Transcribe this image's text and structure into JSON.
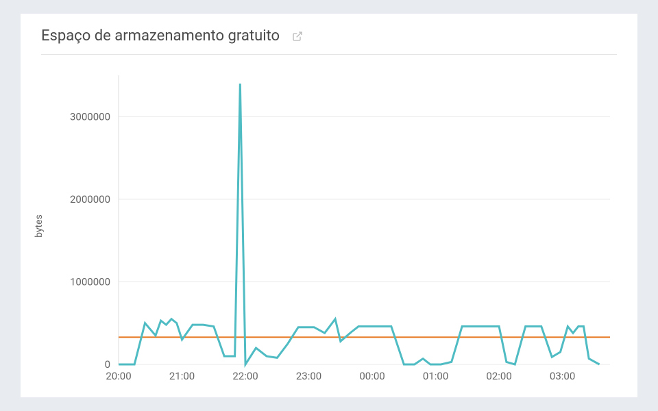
{
  "header": {
    "title": "Espaço de armazenamento gratuito"
  },
  "chart_data": {
    "type": "line",
    "title": "Espaço de armazenamento gratuito",
    "xlabel": "",
    "ylabel": "bytes",
    "ylim": [
      0,
      3500000
    ],
    "x_ticks": [
      "20:00",
      "21:00",
      "22:00",
      "23:00",
      "00:00",
      "01:00",
      "02:00",
      "03:00"
    ],
    "y_ticks": [
      0,
      1000000,
      2000000,
      3000000
    ],
    "reference_value": 330000,
    "series": [
      {
        "name": "bytes",
        "x": [
          "20:00",
          "20:15",
          "20:25",
          "20:35",
          "20:40",
          "20:45",
          "20:50",
          "20:55",
          "21:00",
          "21:10",
          "21:20",
          "21:30",
          "21:40",
          "21:50",
          "21:55",
          "22:00",
          "22:10",
          "22:20",
          "22:30",
          "22:40",
          "22:50",
          "22:58",
          "23:05",
          "23:15",
          "23:25",
          "23:30",
          "23:40",
          "23:47",
          "23:55",
          "00:00",
          "00:10",
          "00:18",
          "00:30",
          "00:40",
          "00:48",
          "00:55",
          "01:05",
          "01:15",
          "01:25",
          "01:35",
          "01:45",
          "01:55",
          "02:00",
          "02:07",
          "02:15",
          "02:25",
          "02:35",
          "02:40",
          "02:50",
          "02:58",
          "03:05",
          "03:10",
          "03:15",
          "03:20",
          "03:25",
          "03:35"
        ],
        "values": [
          0,
          0,
          500000,
          350000,
          530000,
          480000,
          550000,
          500000,
          300000,
          480000,
          480000,
          460000,
          100000,
          100000,
          3400000,
          0,
          200000,
          100000,
          80000,
          250000,
          450000,
          450000,
          450000,
          380000,
          550000,
          280000,
          390000,
          460000,
          460000,
          460000,
          460000,
          460000,
          0,
          0,
          70000,
          0,
          0,
          30000,
          460000,
          460000,
          460000,
          460000,
          460000,
          30000,
          0,
          460000,
          460000,
          460000,
          90000,
          150000,
          460000,
          380000,
          460000,
          460000,
          70000,
          0
        ]
      }
    ]
  }
}
